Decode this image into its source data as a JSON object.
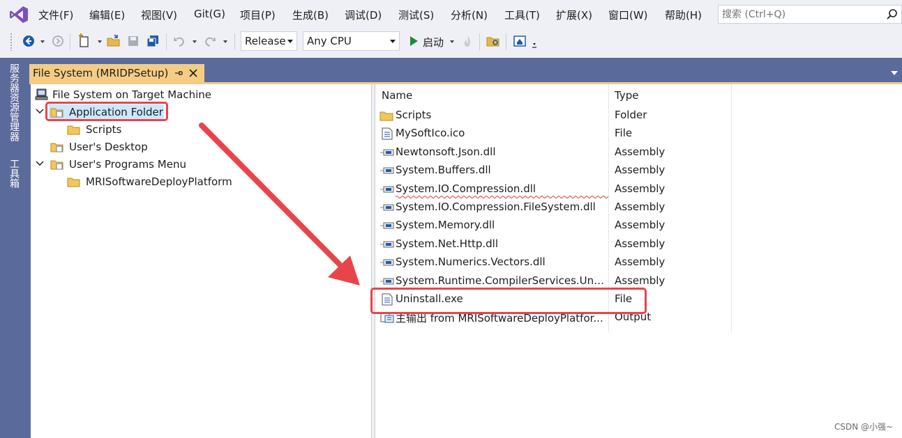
{
  "menu": {
    "items": [
      "文件(F)",
      "编辑(E)",
      "视图(V)",
      "Git(G)",
      "项目(P)",
      "生成(B)",
      "调试(D)",
      "测试(S)",
      "分析(N)",
      "工具(T)",
      "扩展(X)",
      "窗口(W)",
      "帮助(H)"
    ],
    "search_placeholder": "搜索 (Ctrl+Q)"
  },
  "toolbar": {
    "configuration": "Release",
    "platform": "Any CPU",
    "start_label": "启动"
  },
  "side_rail": {
    "tabs": [
      "服务器资源管理器",
      "工具箱"
    ]
  },
  "document_tab": {
    "title": "File System (MRIDPSetup)"
  },
  "tree": {
    "root": "File System on Target Machine",
    "nodes": [
      {
        "label": "Application Folder",
        "expanded": true,
        "selected": true
      },
      {
        "label": "Scripts"
      },
      {
        "label": "User's Desktop"
      },
      {
        "label": "User's Programs Menu",
        "expanded": true
      },
      {
        "label": "MRISoftwareDeployPlatform"
      }
    ]
  },
  "list": {
    "columns": [
      "Name",
      "Type"
    ],
    "rows": [
      {
        "name": "Scripts",
        "type": "Folder",
        "icon": "folder-icon"
      },
      {
        "name": "MySoftIco.ico",
        "type": "File",
        "icon": "file-icon"
      },
      {
        "name": "Newtonsoft.Json.dll",
        "type": "Assembly",
        "icon": "assembly-icon"
      },
      {
        "name": "System.Buffers.dll",
        "type": "Assembly",
        "icon": "assembly-icon"
      },
      {
        "name": "System.IO.Compression.dll",
        "type": "Assembly",
        "icon": "assembly-icon"
      },
      {
        "name": "System.IO.Compression.FileSystem.dll",
        "type": "Assembly",
        "icon": "assembly-icon"
      },
      {
        "name": "System.Memory.dll",
        "type": "Assembly",
        "icon": "assembly-icon"
      },
      {
        "name": "System.Net.Http.dll",
        "type": "Assembly",
        "icon": "assembly-icon"
      },
      {
        "name": "System.Numerics.Vectors.dll",
        "type": "Assembly",
        "icon": "assembly-icon"
      },
      {
        "name": "System.Runtime.CompilerServices.Unsaf...",
        "type": "Assembly",
        "icon": "assembly-icon"
      },
      {
        "name": "Uninstall.exe",
        "type": "File",
        "icon": "file-icon"
      },
      {
        "name": "主输出 from MRISoftwareDeployPlatfor...",
        "type": "Output",
        "icon": "output-icon"
      }
    ]
  },
  "watermark": "CSDN @小强~",
  "colors": {
    "accent_tab": "#f5cc84",
    "well": "#5a6a9a",
    "annotation_red": "#e8454a",
    "selection": "#cce8ff"
  }
}
